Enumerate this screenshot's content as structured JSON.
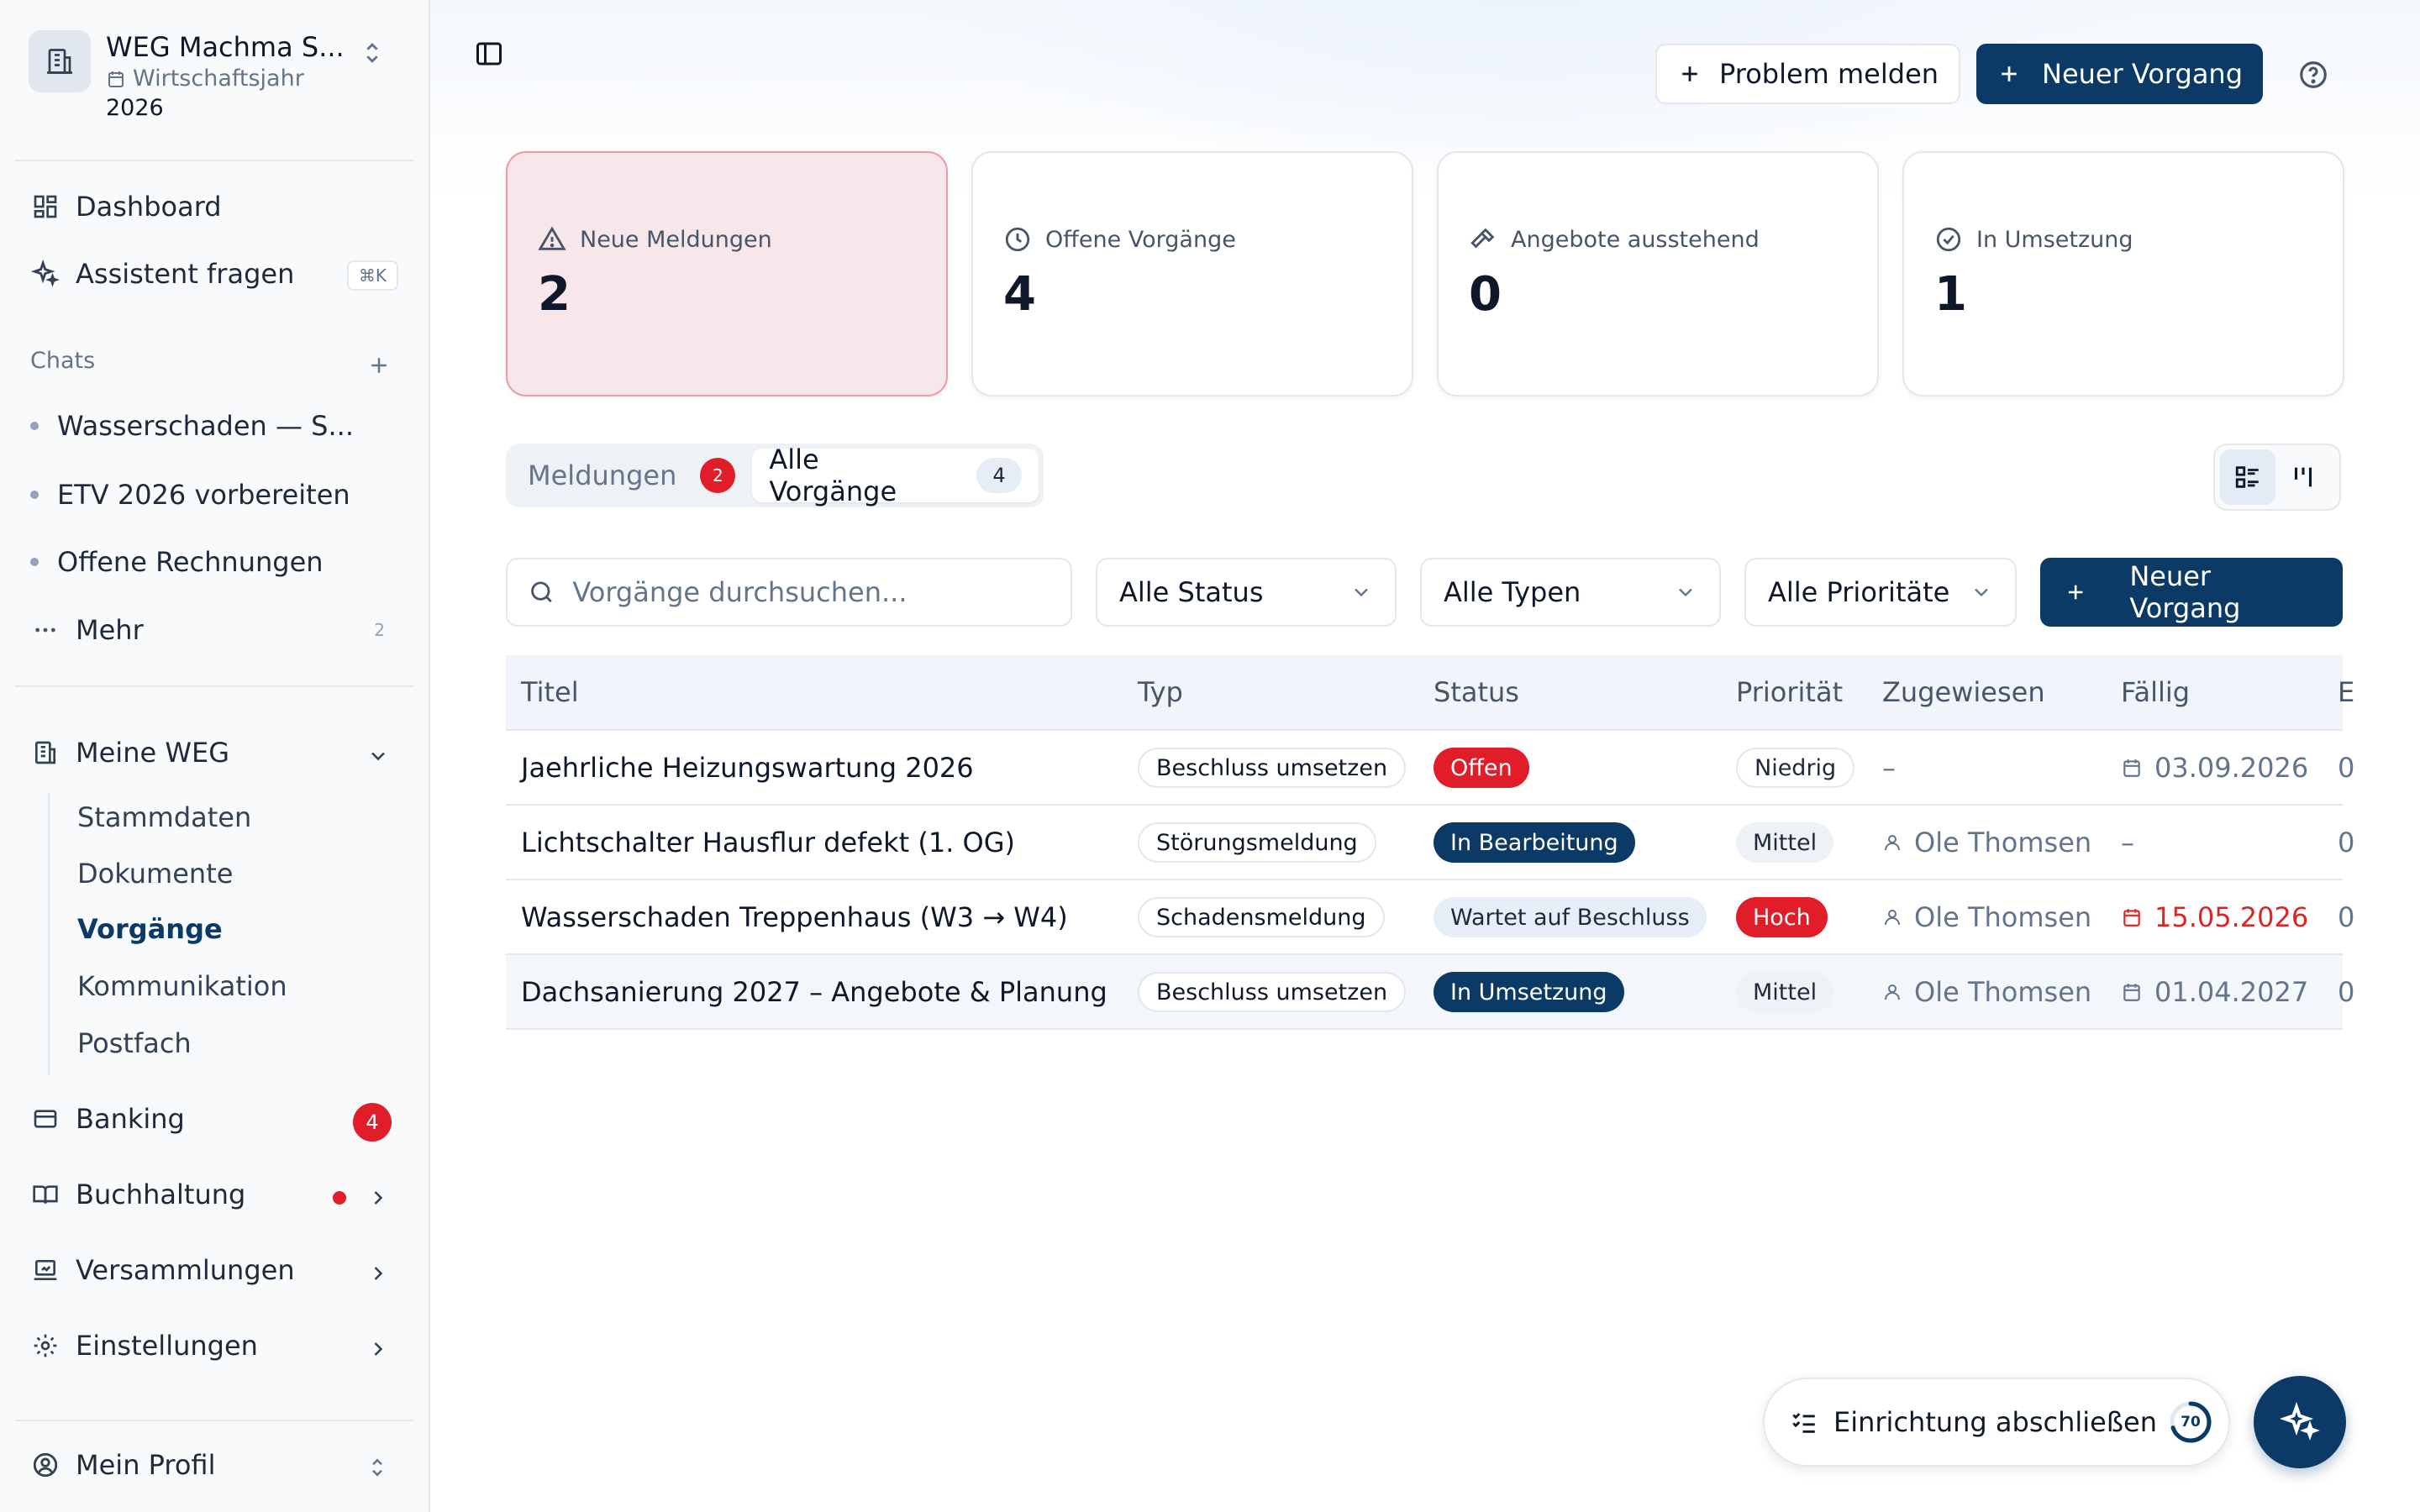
{
  "org": {
    "name": "WEG Machma S...",
    "year_label": "Wirtschaftsjahr",
    "year": "2026"
  },
  "nav": {
    "dashboard": "Dashboard",
    "assistant": "Assistent fragen",
    "assistant_shortcut": "⌘K",
    "chats_label": "Chats",
    "chats": [
      "Wasserschaden — S...",
      "ETV 2026 vorbereiten",
      "Offene Rechnungen"
    ],
    "more": "Mehr",
    "more_count": "2",
    "weg": "Meine WEG",
    "weg_items": [
      "Stammdaten",
      "Dokumente",
      "Vorgänge",
      "Kommunikation",
      "Postfach"
    ],
    "banking": "Banking",
    "banking_badge": "4",
    "buchhaltung": "Buchhaltung",
    "versammlungen": "Versammlungen",
    "einstellungen": "Einstellungen",
    "profil": "Mein Profil"
  },
  "header": {
    "report_problem": "Problem melden",
    "new_case": "Neuer Vorgang"
  },
  "stats": [
    {
      "label": "Neue Meldungen",
      "value": "2"
    },
    {
      "label": "Offene Vorgänge",
      "value": "4"
    },
    {
      "label": "Angebote ausstehend",
      "value": "0"
    },
    {
      "label": "In Umsetzung",
      "value": "1"
    }
  ],
  "tabs": {
    "meldungen": "Meldungen",
    "meldungen_count": "2",
    "alle": "Alle Vorgänge",
    "alle_count": "4"
  },
  "filters": {
    "search_placeholder": "Vorgänge durchsuchen...",
    "status": "Alle Status",
    "typ": "Alle Typen",
    "prio": "Alle Prioritäte",
    "new_case": "Neuer Vorgang"
  },
  "table": {
    "headers": [
      "Titel",
      "Typ",
      "Status",
      "Priorität",
      "Zugewiesen",
      "Fällig",
      "E"
    ],
    "rows": [
      {
        "title": "Jaehrliche Heizungswartung 2026",
        "type": "Beschluss umsetzen",
        "status": "Offen",
        "priority": "Niedrig",
        "assigned": "–",
        "due": "03.09.2026",
        "extra": "0"
      },
      {
        "title": "Lichtschalter Hausflur defekt (1. OG)",
        "type": "Störungsmeldung",
        "status": "In Bearbeitung",
        "priority": "Mittel",
        "assigned": "Ole Thomsen",
        "due": "–",
        "extra": "0"
      },
      {
        "title": "Wasserschaden Treppenhaus (W3 → W4)",
        "type": "Schadensmeldung",
        "status": "Wartet auf Beschluss",
        "priority": "Hoch",
        "assigned": "Ole Thomsen",
        "due": "15.05.2026",
        "extra": "0"
      },
      {
        "title": "Dachsanierung 2027 – Angebote & Planung",
        "type": "Beschluss umsetzen",
        "status": "In Umsetzung",
        "priority": "Mittel",
        "assigned": "Ole Thomsen",
        "due": "01.04.2027",
        "extra": "0"
      }
    ]
  },
  "setup": {
    "label": "Einrichtung abschließen",
    "progress": "70"
  },
  "colors": {
    "primary": "#0c3a66",
    "danger": "#e11d2a",
    "alert_card_bg": "#f7e6ea"
  }
}
